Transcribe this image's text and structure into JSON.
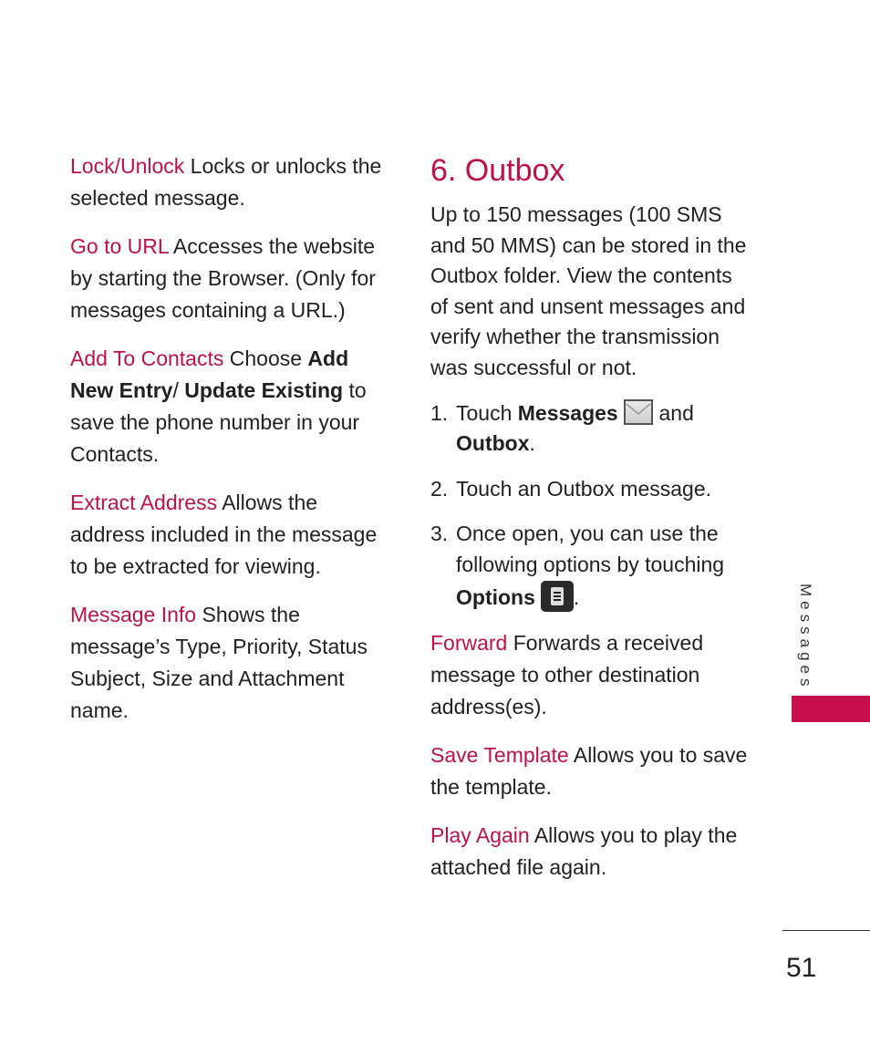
{
  "left_column": {
    "items": [
      {
        "term": "Lock/Unlock",
        "desc": " Locks or unlocks the selected message."
      },
      {
        "term": "Go to URL",
        "desc": " Accesses the website by starting the Browser. (Only for messages containing a URL.)"
      },
      {
        "term": "Add To Contacts",
        "desc_pre": " Choose ",
        "bold1": "Add New Entry",
        "mid": "/ ",
        "bold2": "Update Existing",
        "desc_post": " to save the phone number in your Contacts."
      },
      {
        "term": "Extract Address",
        "desc": " Allows the address included in the message to be extracted for viewing."
      },
      {
        "term": "Message Info",
        "desc": " Shows the message’s Type, Priority, Status Subject, Size and Attachment name."
      }
    ]
  },
  "right_column": {
    "heading": "6. Outbox",
    "intro": "Up to 150 messages (100 SMS and 50 MMS) can be stored in the Outbox folder. View the contents of sent and unsent messages and verify whether the transmission was successful or not.",
    "steps": [
      {
        "num": "1.",
        "pre": "Touch ",
        "bold1": "Messages",
        "mid": " and ",
        "bold2": "Outbox",
        "post": ".",
        "icon": "envelope-icon"
      },
      {
        "num": "2.",
        "text": "Touch an Outbox message."
      },
      {
        "num": "3.",
        "pre": "Once open, you can use the following options by touching ",
        "bold1": "Options",
        "post": ".",
        "icon": "options-menu-icon"
      }
    ],
    "options": [
      {
        "term": "Forward",
        "desc": " Forwards a received message to other destination address(es)."
      },
      {
        "term": "Save Template",
        "desc": " Allows you to save the template."
      },
      {
        "term": "Play Again",
        "desc": " Allows you to play the attached file again."
      }
    ]
  },
  "side_tab": {
    "label": "Messages",
    "color": "#c8104e"
  },
  "page_number": "51",
  "colors": {
    "accent": "#c0104a",
    "text": "#231f20"
  }
}
